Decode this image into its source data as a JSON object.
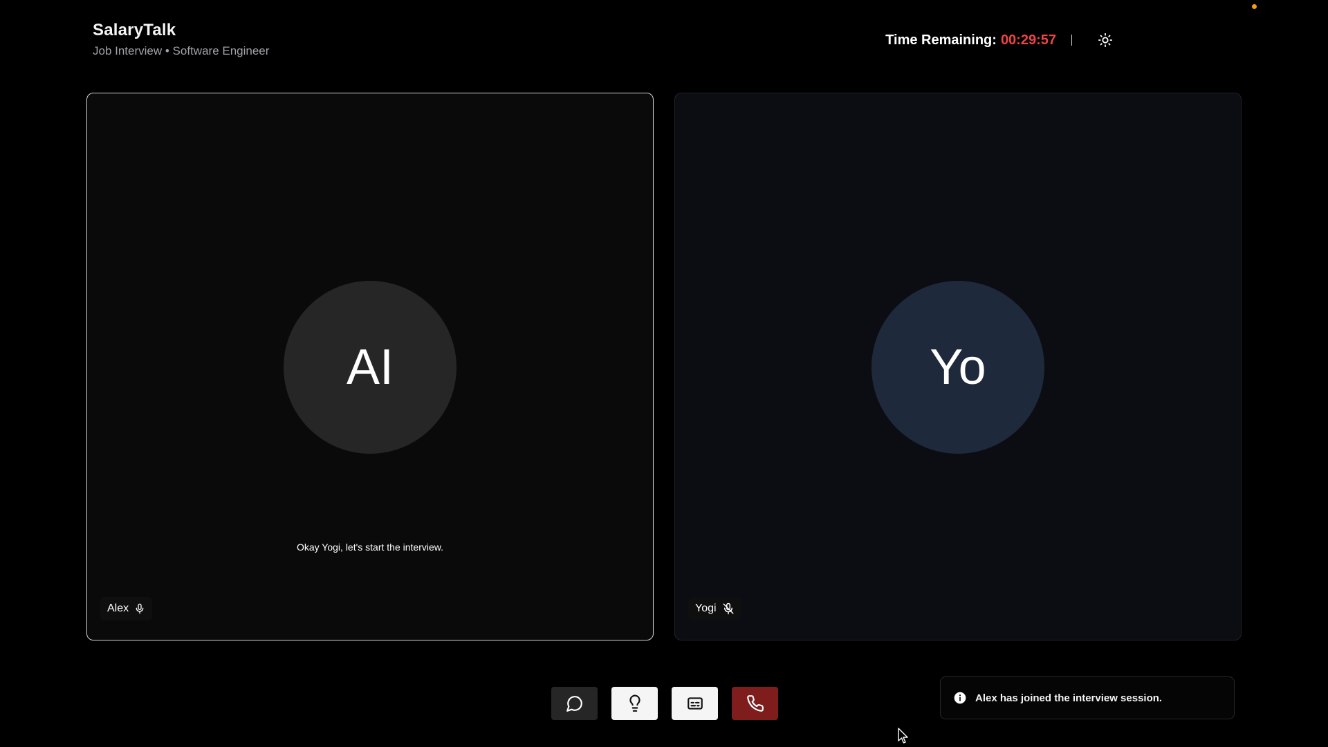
{
  "header": {
    "app_name": "SalaryTalk",
    "subtitle": "Job Interview • Software Engineer",
    "time_label": "Time Remaining:",
    "time_value": "00:29:57",
    "theme_icon": "sun-icon"
  },
  "participants": [
    {
      "initials": "AI",
      "name": "Alex",
      "mic": "mic-on-icon",
      "caption": "Okay Yogi, let's start the interview."
    },
    {
      "initials": "Yo",
      "name": "Yogi",
      "mic": "mic-off-icon"
    }
  ],
  "controls": {
    "chat_icon": "chat-icon",
    "hint_icon": "lightbulb-icon",
    "captions_icon": "captions-icon",
    "end_call_icon": "phone-icon"
  },
  "toast": {
    "icon": "info-icon",
    "message": "Alex has joined the interview session."
  },
  "colors": {
    "timer": "#ef4444",
    "end_call": "#7f1d1d",
    "ai_avatar": "#262626",
    "user_avatar": "#1e293b",
    "status_dot": "#f59e0b"
  }
}
